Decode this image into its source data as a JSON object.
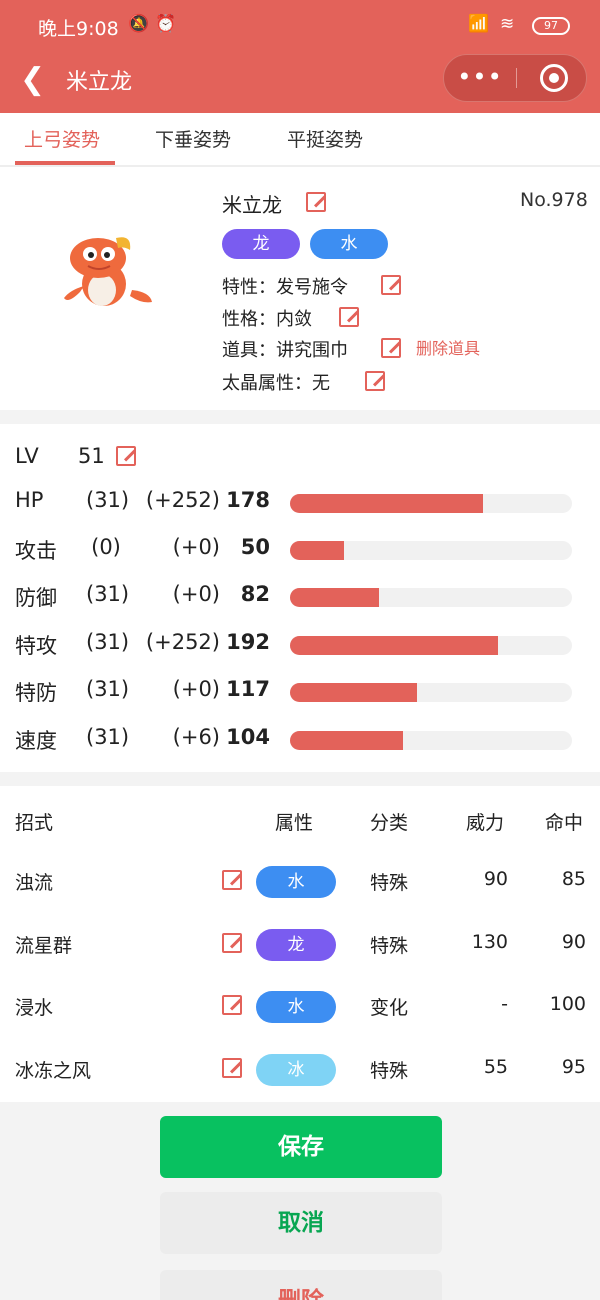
{
  "status_bar": {
    "time": "晚上9:08",
    "battery": "97"
  },
  "nav": {
    "back_icon": "chevron-left-icon",
    "title": "米立龙",
    "more_label": "•••"
  },
  "tabs": [
    {
      "label": "上弓姿势",
      "active": true
    },
    {
      "label": "下垂姿势",
      "active": false
    },
    {
      "label": "平挺姿势",
      "active": false
    }
  ],
  "pokemon": {
    "name": "米立龙",
    "number": "No.978",
    "types": [
      {
        "label": "龙",
        "color": "#7a5cf0"
      },
      {
        "label": "水",
        "color": "#3d8ef2"
      }
    ],
    "ability": "特性：发号施令",
    "nature": "性格：内敛",
    "item": "道具：讲究围巾",
    "remove_item": "删除道具",
    "tera": "太晶属性：无"
  },
  "stats": {
    "lv_label": "LV",
    "lv": "51",
    "max_value": 260,
    "rows": [
      {
        "name": "HP",
        "iv": "(31)",
        "ev": "(+252)",
        "total": "178",
        "value": 178
      },
      {
        "name": "攻击",
        "iv": "(0)",
        "ev": "(+0)",
        "total": "50",
        "value": 50
      },
      {
        "name": "防御",
        "iv": "(31)",
        "ev": "(+0)",
        "total": "82",
        "value": 82
      },
      {
        "name": "特攻",
        "iv": "(31)",
        "ev": "(+252)",
        "total": "192",
        "value": 192
      },
      {
        "name": "特防",
        "iv": "(31)",
        "ev": "(+0)",
        "total": "117",
        "value": 117
      },
      {
        "name": "速度",
        "iv": "(31)",
        "ev": "(+6)",
        "total": "104",
        "value": 104
      }
    ]
  },
  "moves": {
    "headers": {
      "name": "招式",
      "type": "属性",
      "category": "分类",
      "power": "威力",
      "accuracy": "命中"
    },
    "rows": [
      {
        "name": "浊流",
        "type": "水",
        "type_color": "#3d8ef2",
        "category": "特殊",
        "power": "90",
        "accuracy": "85"
      },
      {
        "name": "流星群",
        "type": "龙",
        "type_color": "#7a5cf0",
        "category": "特殊",
        "power": "130",
        "accuracy": "90"
      },
      {
        "name": "浸水",
        "type": "水",
        "type_color": "#3d8ef2",
        "category": "变化",
        "power": "-",
        "accuracy": "100"
      },
      {
        "name": "冰冻之风",
        "type": "冰",
        "type_color": "#7fd3f5",
        "category": "特殊",
        "power": "55",
        "accuracy": "95"
      }
    ]
  },
  "actions": {
    "save": "保存",
    "cancel": "取消",
    "delete": "删除"
  },
  "colors": {
    "accent": "#e3625a",
    "save_green": "#08c160"
  }
}
